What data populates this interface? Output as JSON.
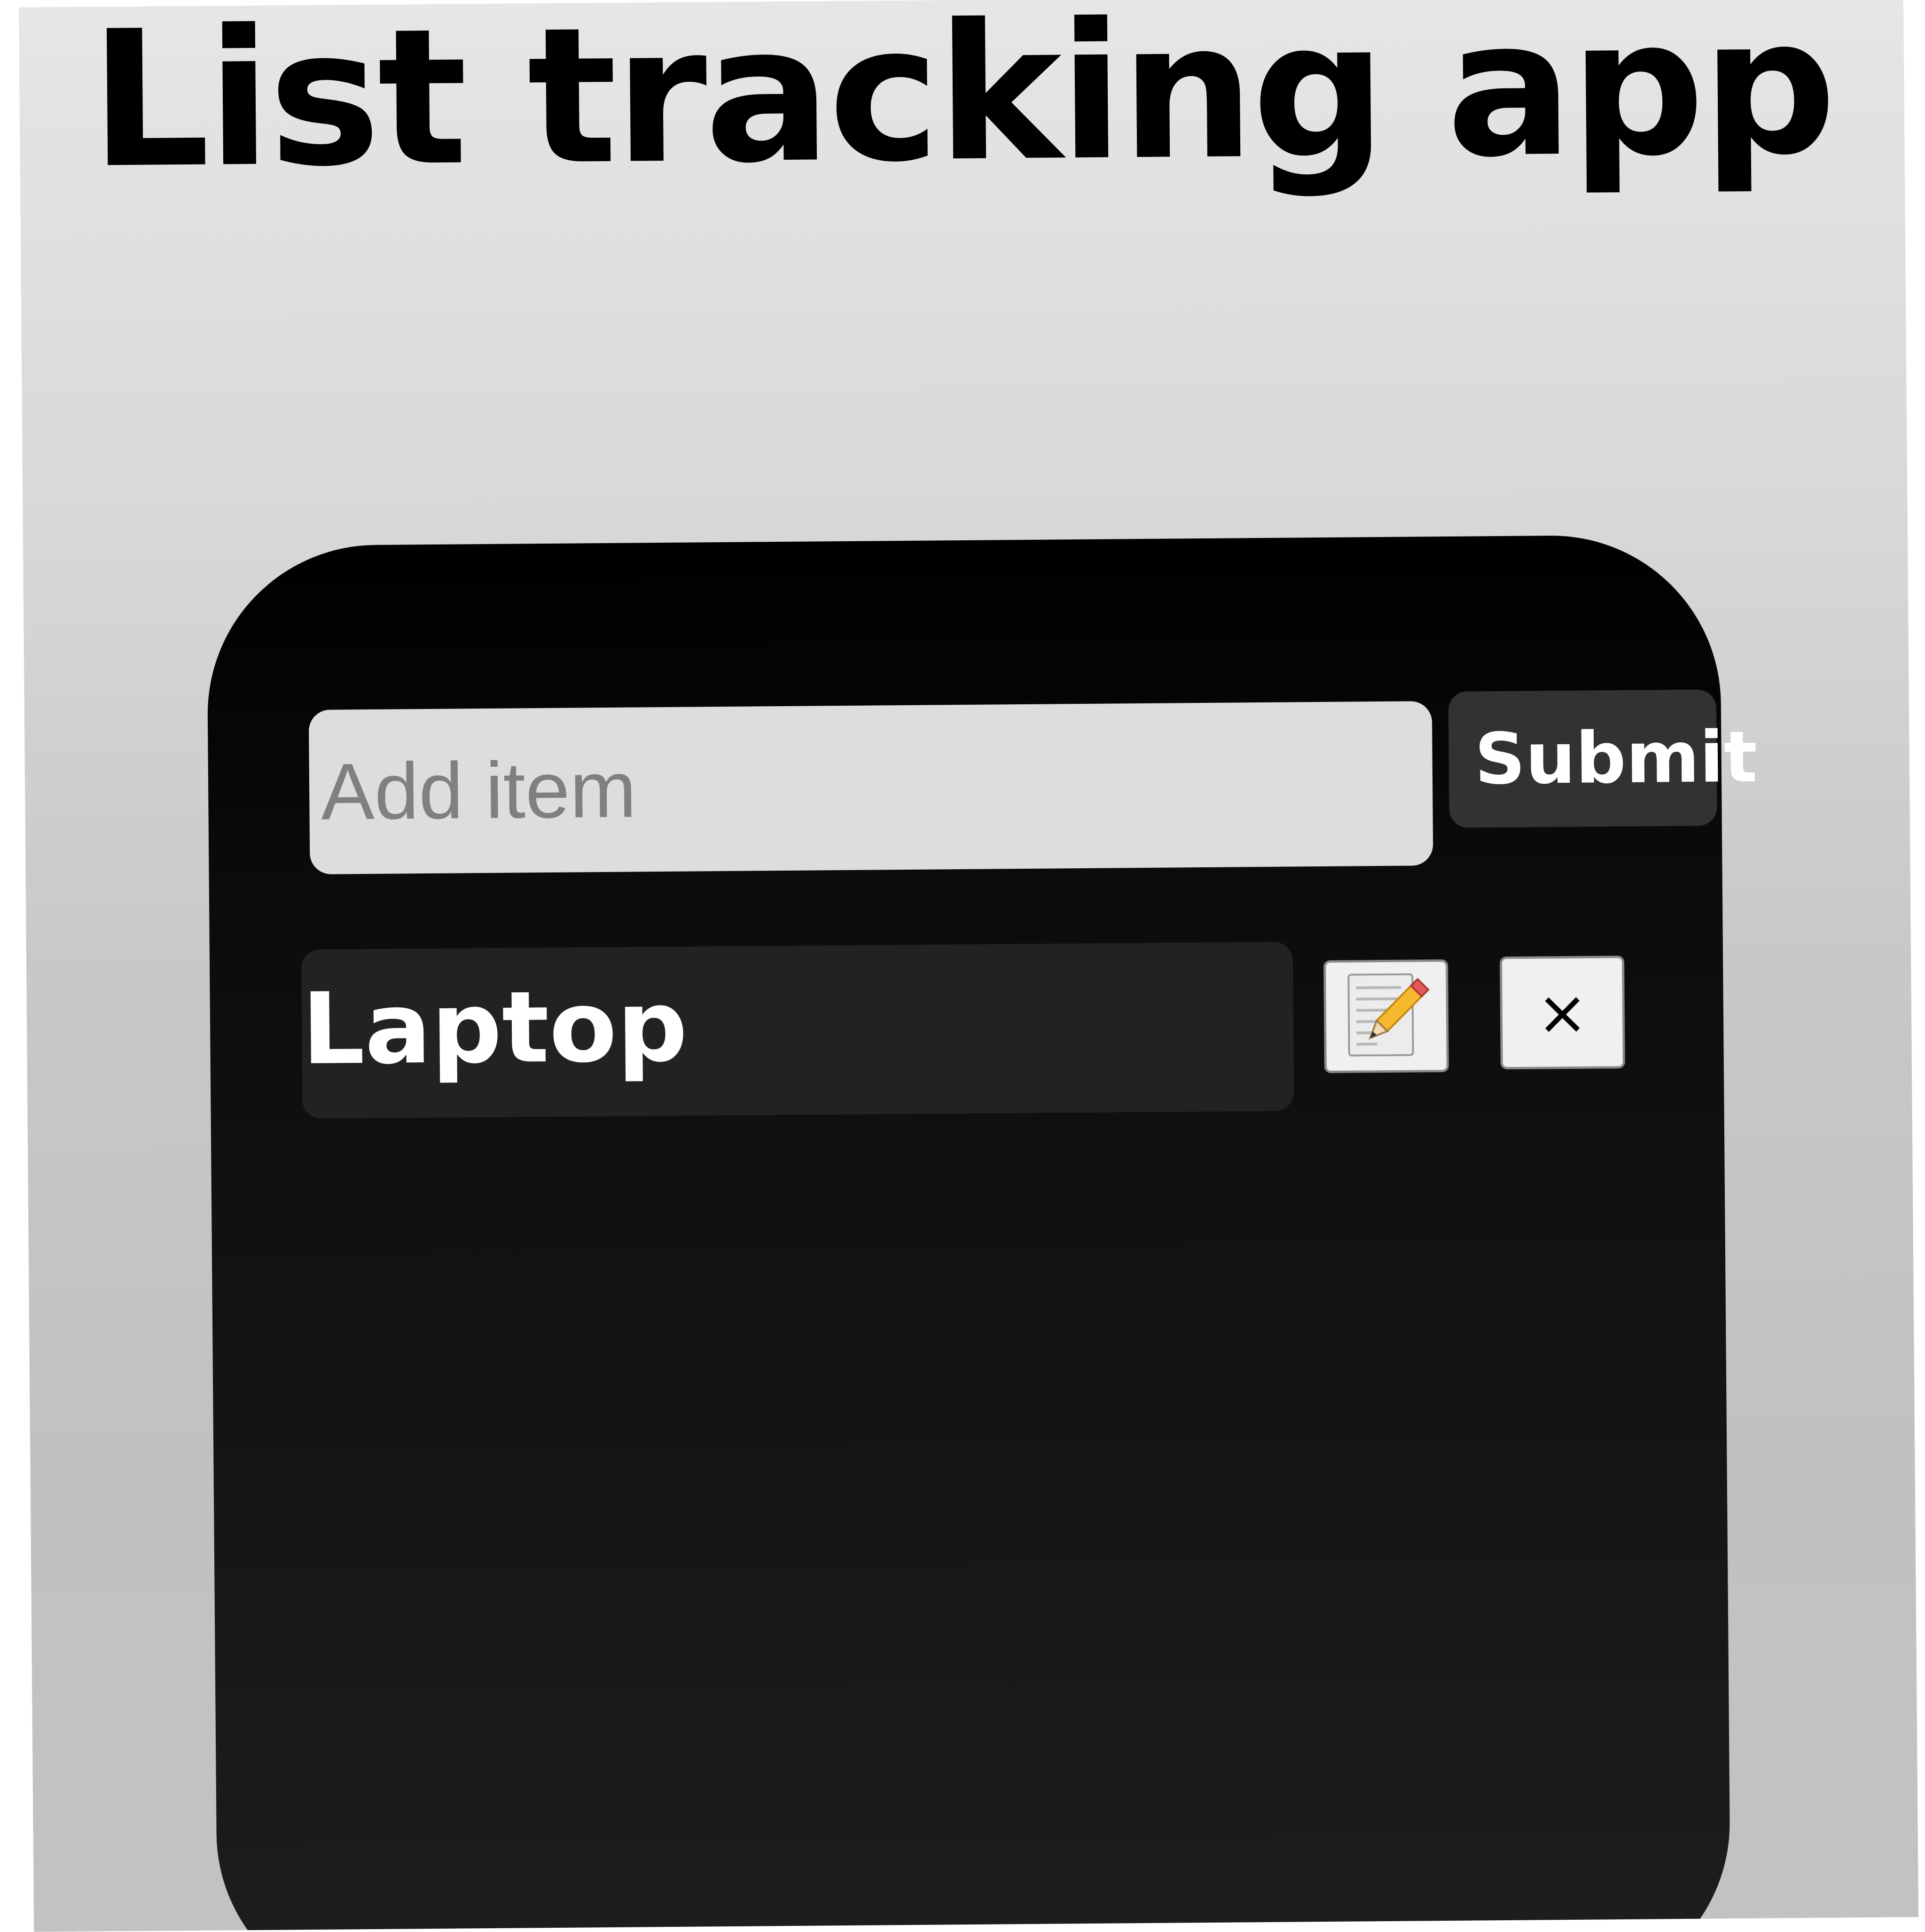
{
  "app": {
    "title": "List tracking app"
  },
  "add_form": {
    "input_placeholder": "Add item",
    "input_value": "",
    "submit_label": "Submit"
  },
  "items": [
    {
      "label": "Laptop",
      "edit_icon": "pencil-notepad-icon",
      "delete_icon": "close-icon",
      "delete_symbol": "×"
    }
  ],
  "colors": {
    "page_background_top": "#e7e6e4",
    "page_background_bottom": "#c2c2c2",
    "card_background": "#000000",
    "input_background": "#dddddd",
    "submit_background": "#323232",
    "item_background": "#222222",
    "icon_button_background": "#f0f0f0"
  }
}
